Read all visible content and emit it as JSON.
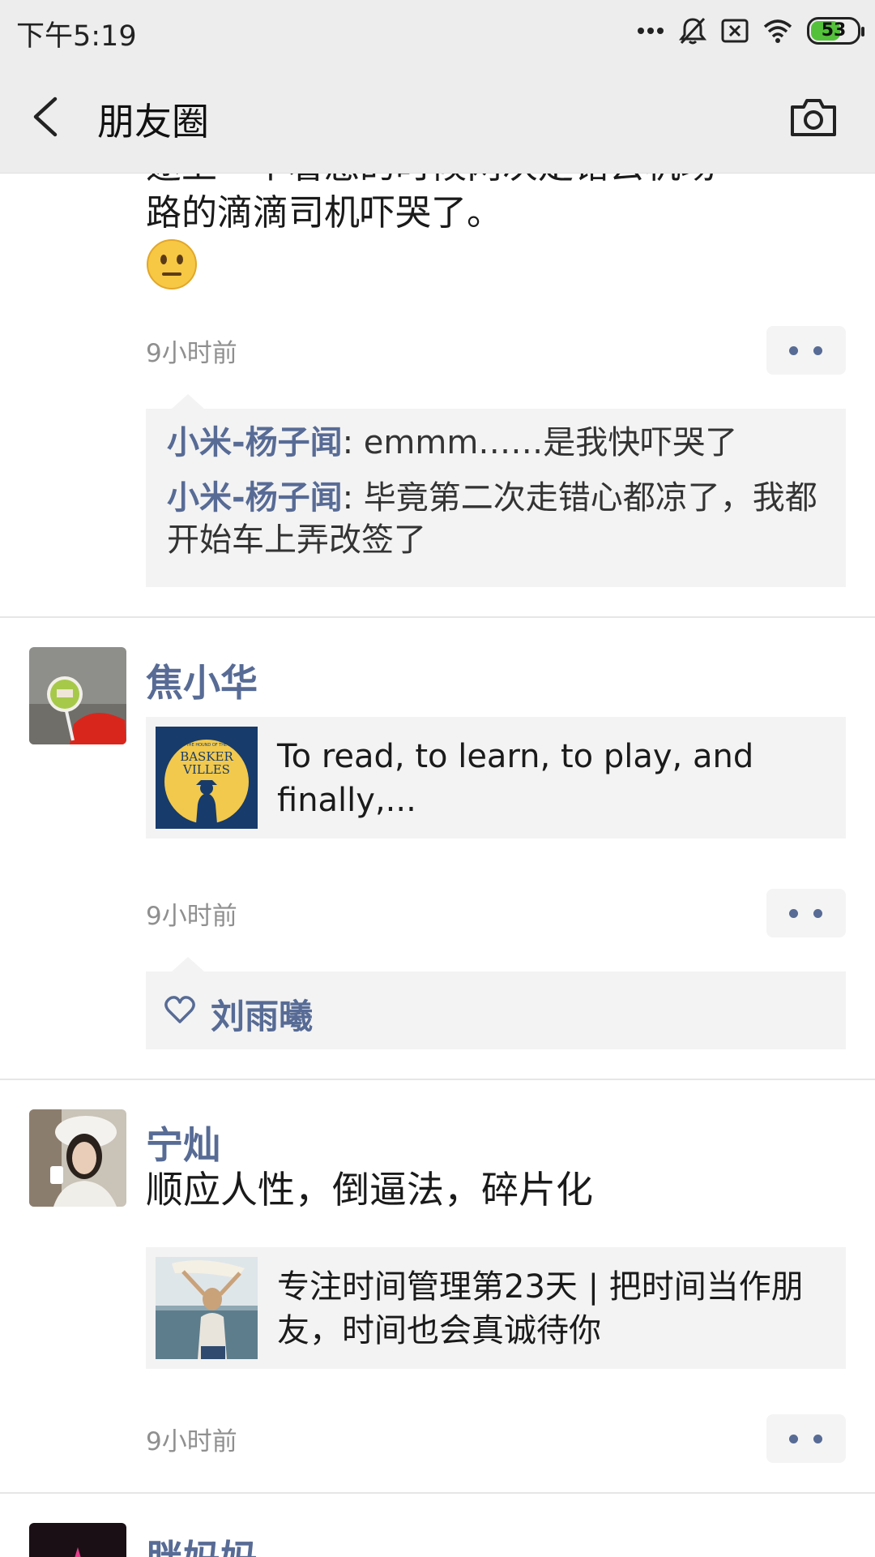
{
  "status_bar": {
    "time": "下午5:19",
    "battery_level": "53",
    "icons": [
      "more-dots-icon",
      "mute-bell-icon",
      "no-sim-icon",
      "wifi-icon",
      "battery-icon"
    ]
  },
  "nav": {
    "title": "朋友圈",
    "back_icon": "back-chevron-icon",
    "camera_icon": "camera-icon"
  },
  "colors": {
    "name_blue": "#576b95",
    "nav_bg": "#ededed",
    "card_bg": "#f3f3f3"
  },
  "posts": [
    {
      "text_partial_hidden": "途上一个着急的时候两次走错去机场",
      "text_line": "路的滴滴司机吓哭了。",
      "emoji": "😐",
      "time": "9小时前",
      "comments": [
        {
          "name": "小米-杨子闻",
          "text": ": emmm……是我快吓哭了"
        },
        {
          "name": "小米-杨子闻",
          "text": ": 毕竟第二次走错心都凉了，我都开始车上弄改签了"
        }
      ]
    },
    {
      "name": "焦小华",
      "link": {
        "thumb_text_top": "THE HOUND OF THE",
        "thumb_text_main1": "BASKER",
        "thumb_text_main2": "VILLES",
        "text": "To read, to learn, to play, and finally,..."
      },
      "time": "9小时前",
      "likes": [
        "刘雨曦"
      ]
    },
    {
      "name": "宁灿",
      "text": "顺应人性，倒逼法，碎片化",
      "link": {
        "text": "专注时间管理第23天 | 把时间当作朋友，时间也会真诚待你"
      },
      "time": "9小时前"
    },
    {
      "name": "胖妈妈"
    }
  ]
}
